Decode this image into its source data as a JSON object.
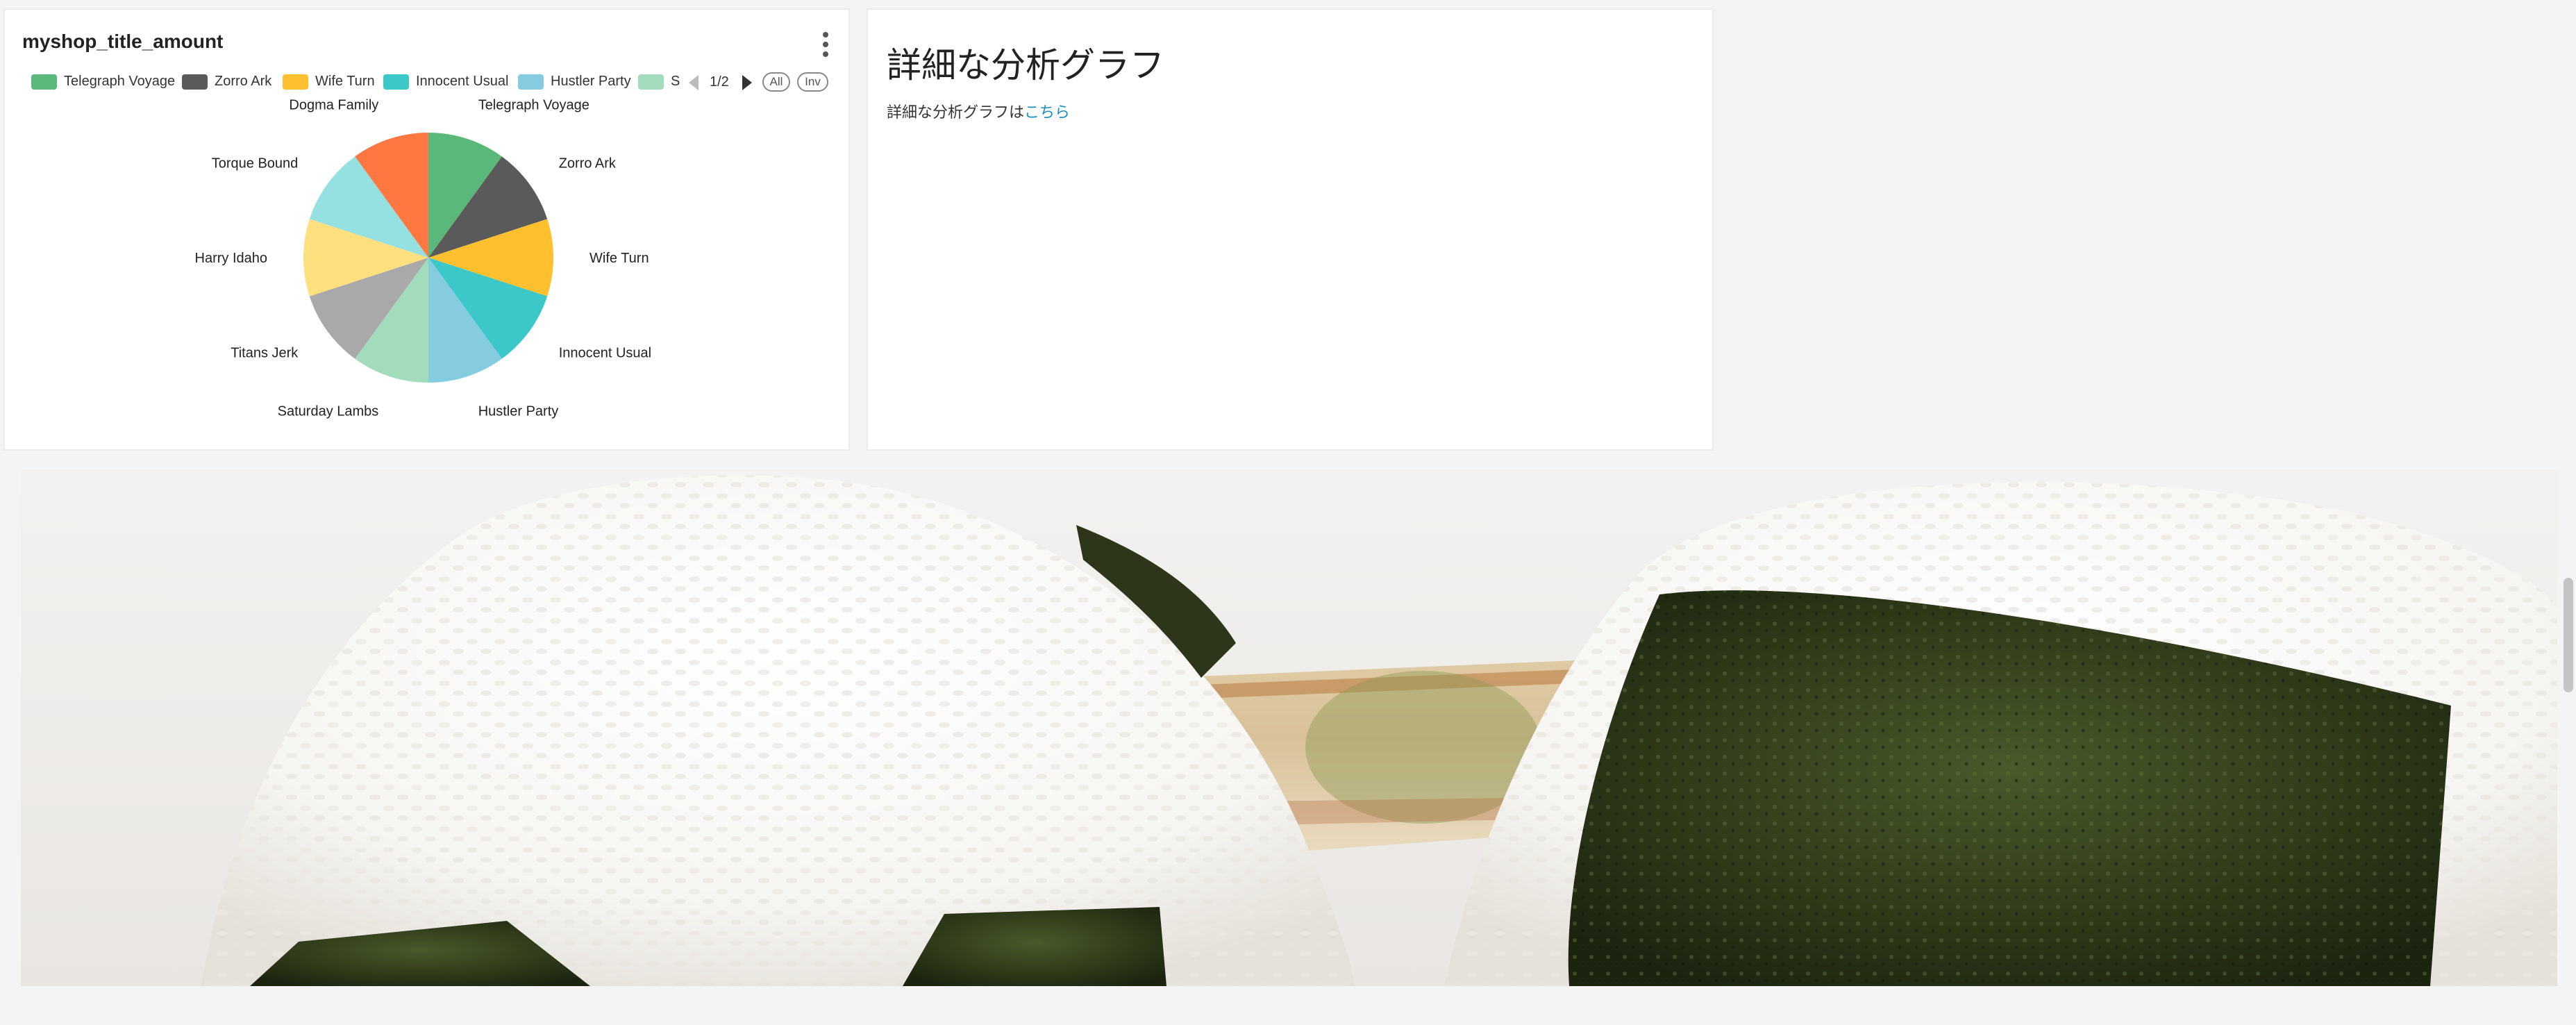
{
  "chart_panel": {
    "title": "myshop_title_amount",
    "legend": {
      "page": "1/2",
      "all_label": "All",
      "inv_label": "Inv",
      "items": [
        {
          "label": "Telegraph Voyage",
          "color": "#5bb87b"
        },
        {
          "label": "Zorro Ark",
          "color": "#5a5a5a"
        },
        {
          "label": "Wife Turn",
          "color": "#ffc030"
        },
        {
          "label": "Innocent Usual",
          "color": "#3cc8c8"
        },
        {
          "label": "Hustler Party",
          "color": "#85cce0"
        },
        {
          "label": "S",
          "color": "#a3dcbc"
        }
      ]
    }
  },
  "chart_data": {
    "type": "pie",
    "title": "myshop_title_amount",
    "labels": [
      "Telegraph Voyage",
      "Zorro Ark",
      "Wife Turn",
      "Innocent Usual",
      "Hustler Party",
      "Saturday Lambs",
      "Titans Jerk",
      "Harry Idaho",
      "Torque Bound",
      "Dogma Family"
    ],
    "values": [
      10,
      10,
      10,
      10,
      10,
      10,
      10,
      10,
      10,
      10
    ],
    "colors": [
      "#5bb87b",
      "#5a5a5a",
      "#ffc030",
      "#3cc8c8",
      "#85cce0",
      "#a3dcbc",
      "#a9a9a9",
      "#ffe07e",
      "#95e1e1",
      "#ff7842"
    ],
    "legend_position": "top"
  },
  "text_panel": {
    "heading": "詳細な分析グラフ",
    "body_prefix": "詳細な分析グラフは",
    "link_text": "こちら"
  },
  "photo": {
    "subject": "onigiri-photo"
  }
}
